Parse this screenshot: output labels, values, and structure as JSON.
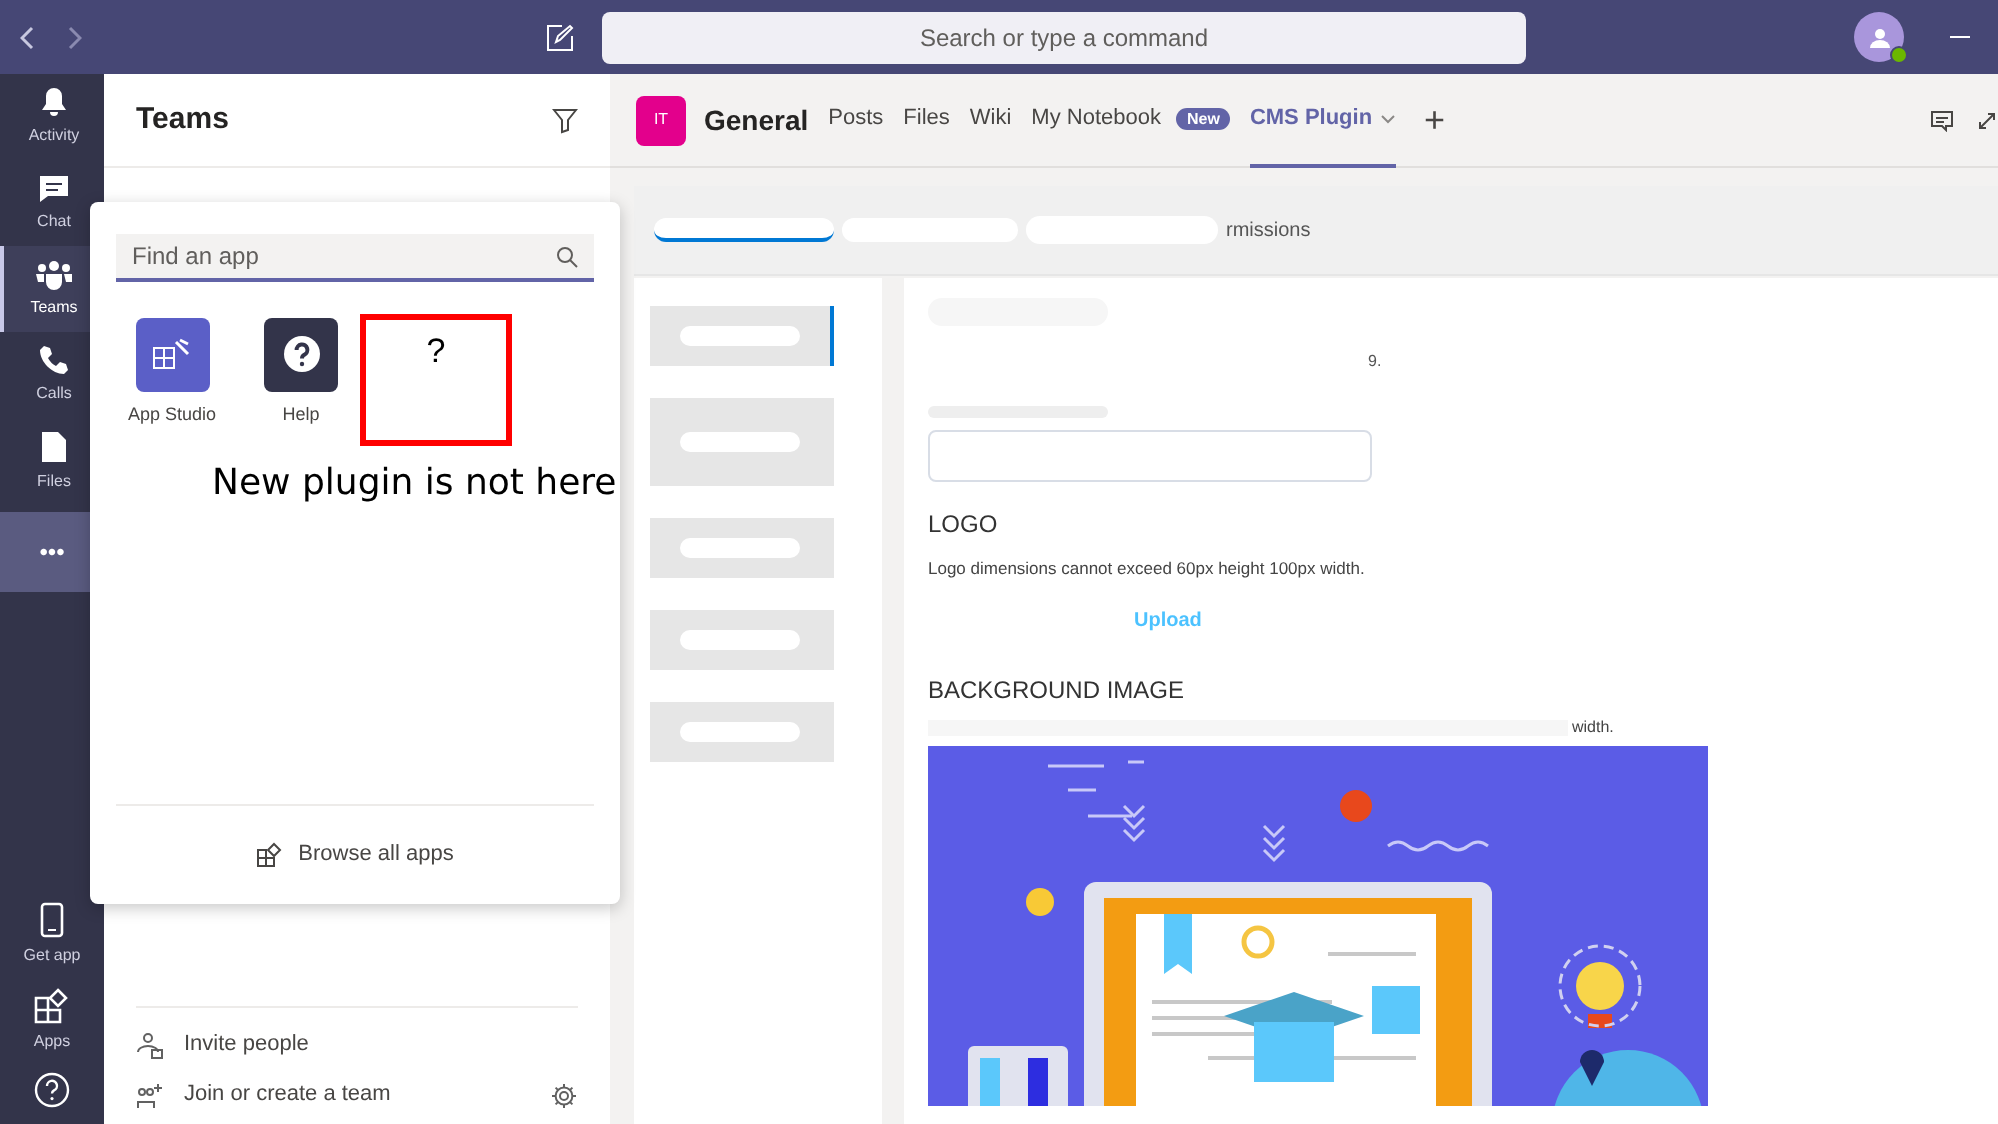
{
  "top_bar": {
    "search_placeholder": "Search or type a command"
  },
  "rail": {
    "items": [
      {
        "label": "Activity",
        "kind": "bell",
        "selected": false
      },
      {
        "label": "Chat",
        "kind": "chat",
        "selected": false
      },
      {
        "label": "Teams",
        "kind": "teams",
        "selected": true
      },
      {
        "label": "Calls",
        "kind": "phone",
        "selected": false
      },
      {
        "label": "Files",
        "kind": "file",
        "selected": false
      }
    ],
    "more": {
      "label": "•••",
      "open": true
    },
    "bottom_items": [
      {
        "label": "Get app",
        "kind": "phone-device"
      },
      {
        "label": "Apps",
        "kind": "apps"
      }
    ]
  },
  "teams_panel": {
    "title": "Teams",
    "footer": [
      {
        "label": "Invite people",
        "kind": "invite"
      },
      {
        "label": "Join or create a team",
        "kind": "join"
      }
    ]
  },
  "app_flyout": {
    "search": {
      "placeholder": "Find an app"
    },
    "apps": [
      {
        "label": "App Studio",
        "kind": "studio",
        "color": "#5b5fc7"
      },
      {
        "label": "Help",
        "kind": "help",
        "color": "#33344a"
      }
    ],
    "annotation": {
      "mark": "?",
      "caption": "New plugin is not here"
    },
    "browse": "Browse all apps"
  },
  "channel": {
    "avatar": "IT",
    "name": "General",
    "tabs": [
      {
        "label": "Posts",
        "selected": false
      },
      {
        "label": "Files",
        "selected": false
      },
      {
        "label": "Wiki",
        "selected": false
      },
      {
        "label": "My Notebook",
        "badge": "New",
        "selected": false
      },
      {
        "label": "CMS Plugin",
        "selected": true,
        "dropdown": true
      }
    ],
    "add": "+"
  },
  "plugin": {
    "subtabs_fragment": "rmissions",
    "menu_items": [
      {
        "selected": true
      },
      {
        "selected": false
      },
      {
        "selected": false
      },
      {
        "selected": false
      },
      {
        "selected": false
      }
    ],
    "fragment_9": "9.",
    "logo": {
      "heading": "LOGO",
      "hint": "Logo dimensions cannot exceed 60px height 100px width.",
      "upload": "Upload"
    },
    "background": {
      "heading": "BACKGROUND IMAGE",
      "hint_fragment": "width."
    }
  }
}
